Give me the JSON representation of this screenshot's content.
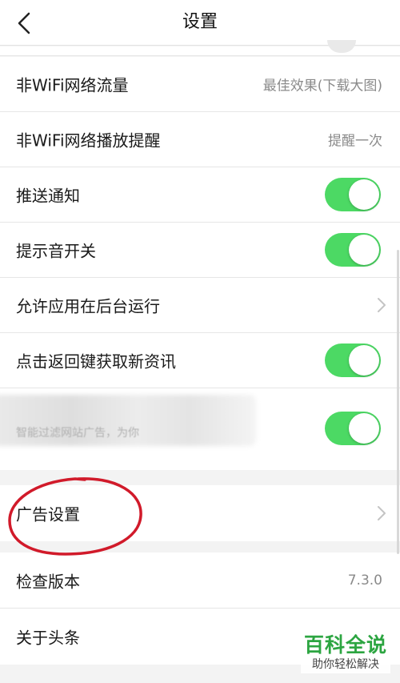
{
  "header": {
    "title": "设置"
  },
  "rows_group1": [
    {
      "label": "非WiFi网络流量",
      "value": "最佳效果(下载大图)"
    },
    {
      "label": "非WiFi网络播放提醒",
      "value": "提醒一次"
    },
    {
      "label": "推送通知",
      "toggle": true
    },
    {
      "label": "提示音开关",
      "toggle": true
    },
    {
      "label": "允许应用在后台运行"
    },
    {
      "label": "点击返回键获取新资讯",
      "toggle": true
    },
    {
      "label": "智能过滤网站广告，为你",
      "toggle": true
    }
  ],
  "rows_group2": [
    {
      "label": "广告设置"
    }
  ],
  "rows_group3": [
    {
      "label": "检查版本",
      "value": "7.3.0"
    },
    {
      "label": "关于头条"
    }
  ],
  "watermark": {
    "title": "百科全说",
    "subtitle": "助你轻松解决"
  },
  "colors": {
    "toggle_on": "#4cd964",
    "annotation": "#d11a2a",
    "watermark": "#2ca541"
  }
}
